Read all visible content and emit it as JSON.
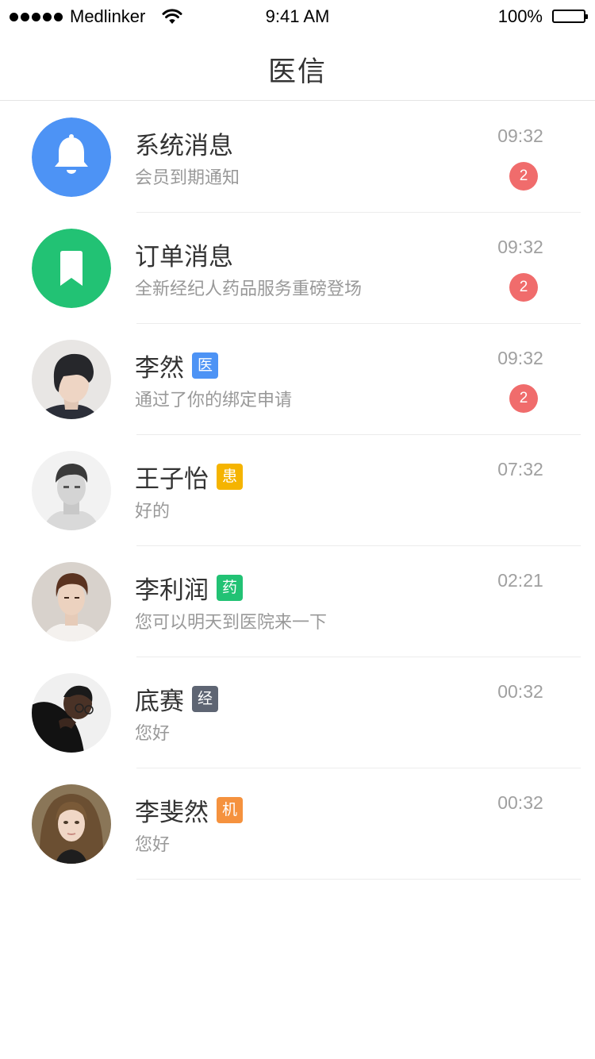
{
  "status_bar": {
    "carrier": "Medlinker",
    "time": "9:41 AM",
    "battery": "100%"
  },
  "header": {
    "title": "医信"
  },
  "colors": {
    "system_blue": "#4d93f5",
    "order_green": "#22c274",
    "badge_red": "#f06c6c",
    "tag_doctor": "#4d93f5",
    "tag_patient": "#f5b400",
    "tag_pharmacy": "#22c274",
    "tag_agent": "#5e6573",
    "tag_institution": "#f5923e"
  },
  "conversations": [
    {
      "name": "系统消息",
      "preview": "会员到期通知",
      "time": "09:32",
      "unread": "2",
      "icon": "bell-icon"
    },
    {
      "name": "订单消息",
      "preview": "全新经纪人药品服务重磅登场",
      "time": "09:32",
      "unread": "2",
      "icon": "bookmark-icon"
    },
    {
      "name": "李然",
      "tag": "医",
      "tag_color": "#4d93f5",
      "preview": "通过了你的绑定申请",
      "time": "09:32",
      "unread": "2"
    },
    {
      "name": "王子怡",
      "tag": "患",
      "tag_color": "#f5b400",
      "preview": "好的",
      "time": "07:32"
    },
    {
      "name": "李利润",
      "tag": "药",
      "tag_color": "#22c274",
      "preview": "您可以明天到医院来一下",
      "time": "02:21"
    },
    {
      "name": "底赛",
      "tag": "经",
      "tag_color": "#5e6573",
      "preview": "您好",
      "time": "00:32"
    },
    {
      "name": "李斐然",
      "tag": "机",
      "tag_color": "#f5923e",
      "preview": "您好",
      "time": "00:32"
    }
  ]
}
